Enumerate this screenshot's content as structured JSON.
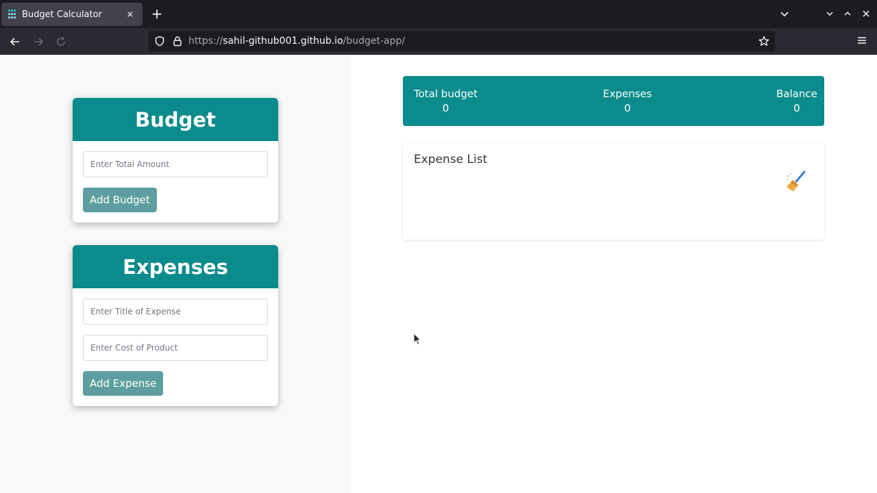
{
  "browser": {
    "tab_title": "Budget Calculator",
    "tab_close": "×",
    "new_tab": "+",
    "url_prefix": "https://",
    "url_host": "sahil-github001.github.io",
    "url_path": "/budget-app/"
  },
  "budget_card": {
    "heading": "Budget",
    "amount_placeholder": "Enter Total Amount",
    "add_button": "Add Budget"
  },
  "expenses_card": {
    "heading": "Expenses",
    "title_placeholder": "Enter Title of Expense",
    "cost_placeholder": "Enter Cost of Product",
    "add_button": "Add Expense"
  },
  "summary": {
    "total_budget_label": "Total budget",
    "total_budget_value": "0",
    "expenses_label": "Expenses",
    "expenses_value": "0",
    "balance_label": "Balance",
    "balance_value": "0"
  },
  "expense_list": {
    "title": "Expense List"
  },
  "colors": {
    "accent": "#0b8b8c",
    "button": "#5e9ea0",
    "tabbar": "#1c1b22",
    "navbar": "#2b2a33"
  },
  "icons": [
    "calculator-favicon-icon",
    "back-arrow-icon",
    "forward-arrow-icon",
    "reload-icon",
    "shield-icon",
    "lock-icon",
    "star-icon",
    "hamburger-menu-icon",
    "chevron-down-icon",
    "minimize-icon",
    "maximize-icon",
    "close-window-icon",
    "broom-icon",
    "mouse-cursor-icon"
  ]
}
